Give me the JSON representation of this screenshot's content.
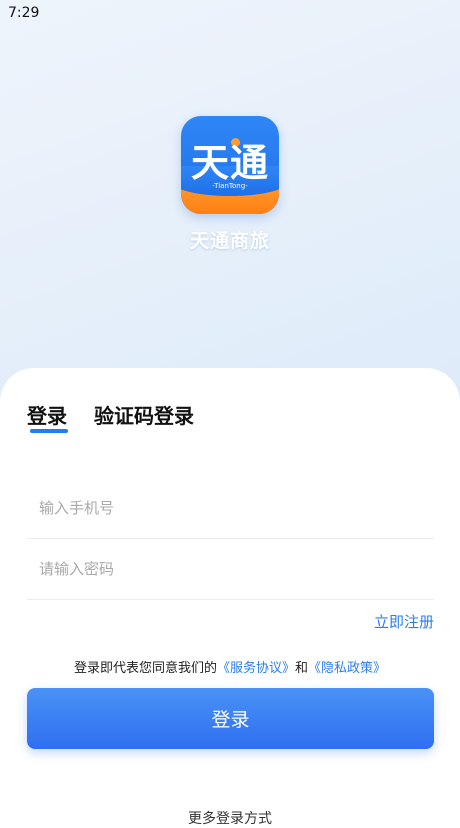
{
  "status_bar": {
    "time": "7:29"
  },
  "app": {
    "logo_text": "天通",
    "logo_sub": "-TianTong-",
    "name": "天通商旅"
  },
  "tabs": [
    {
      "label": "登录",
      "active": true
    },
    {
      "label": "验证码登录",
      "active": false
    }
  ],
  "form": {
    "phone_placeholder": "输入手机号",
    "password_placeholder": "请输入密码",
    "register_label": "立即注册"
  },
  "agreement": {
    "prefix": "登录即代表您同意我们的",
    "service_link": "《服务协议》",
    "conjunction": "和",
    "privacy_link": "《隐私政策》"
  },
  "login_button_label": "登录",
  "more_methods_label": "更多登录方式",
  "colors": {
    "accent": "#2a7ef0",
    "logo_blue": "#1f6fe6",
    "logo_orange": "#ff8a1f"
  }
}
